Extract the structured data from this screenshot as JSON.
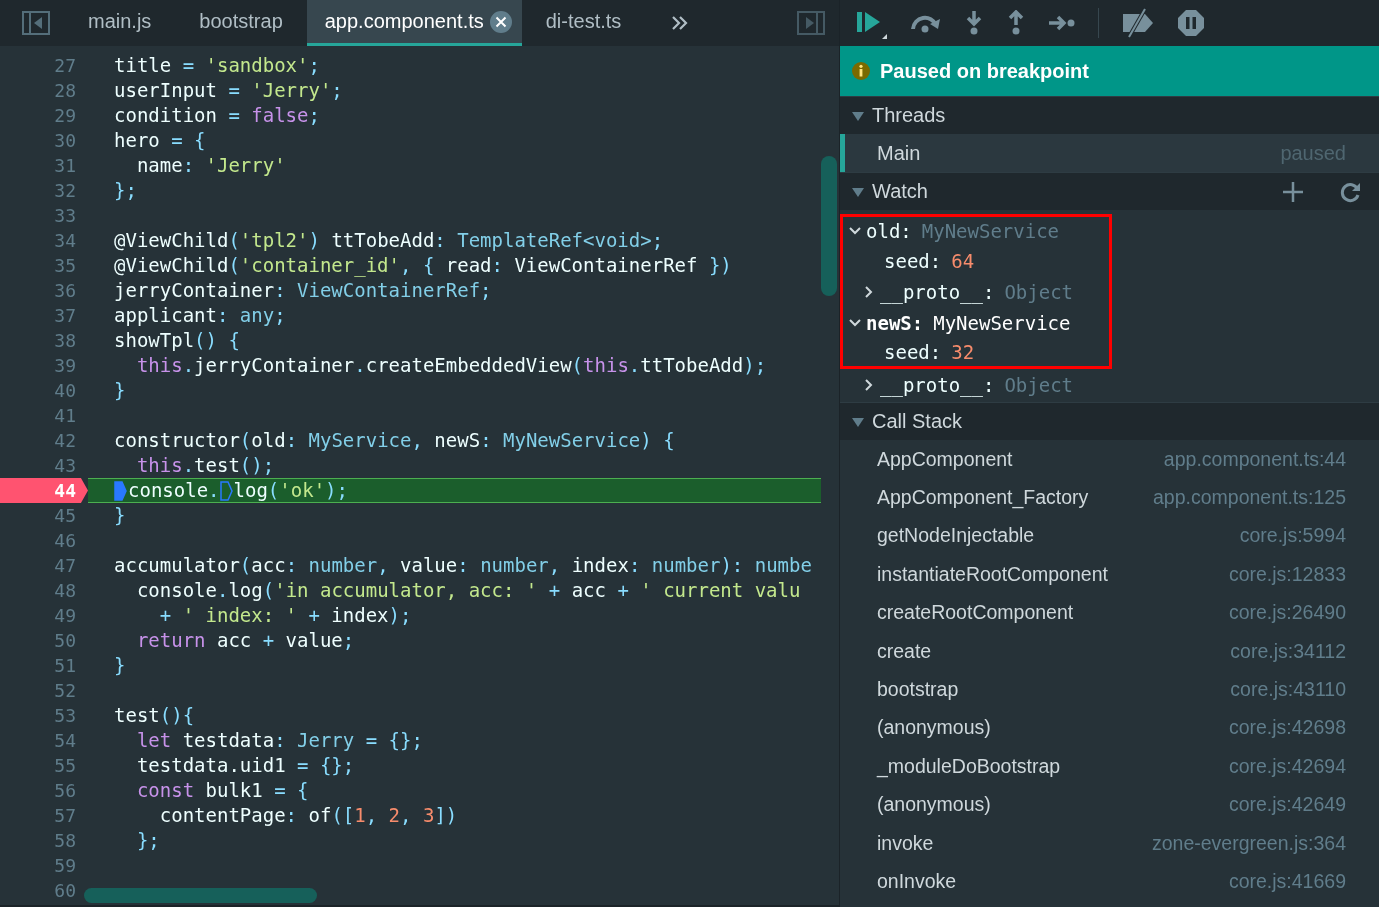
{
  "tabs": [
    {
      "label": "main.js",
      "selected": false
    },
    {
      "label": "bootstrap",
      "selected": false
    },
    {
      "label": "app.component.ts",
      "selected": true
    },
    {
      "label": "di-test.ts",
      "selected": false
    }
  ],
  "editor": {
    "lines": [
      {
        "number": "27",
        "kind": "code",
        "tokens": [
          {
            "kind": "plain",
            "text": "title "
          },
          {
            "kind": "punct",
            "text": "= "
          },
          {
            "kind": "string",
            "text": "'sandbox'"
          },
          {
            "kind": "punct",
            "text": ";"
          }
        ]
      },
      {
        "number": "28",
        "kind": "code",
        "tokens": [
          {
            "kind": "plain",
            "text": "userInput "
          },
          {
            "kind": "punct",
            "text": "= "
          },
          {
            "kind": "string",
            "text": "'Jerry'"
          },
          {
            "kind": "punct",
            "text": ";"
          }
        ]
      },
      {
        "number": "29",
        "kind": "code",
        "tokens": [
          {
            "kind": "plain",
            "text": "condition "
          },
          {
            "kind": "punct",
            "text": "= "
          },
          {
            "kind": "keyword",
            "text": "false"
          },
          {
            "kind": "punct",
            "text": ";"
          }
        ]
      },
      {
        "number": "30",
        "kind": "code",
        "tokens": [
          {
            "kind": "plain",
            "text": "hero "
          },
          {
            "kind": "punct",
            "text": "= {"
          }
        ]
      },
      {
        "number": "31",
        "kind": "code",
        "tokens": [
          {
            "kind": "plain",
            "text": "  name"
          },
          {
            "kind": "punct",
            "text": ": "
          },
          {
            "kind": "string",
            "text": "'Jerry'"
          }
        ]
      },
      {
        "number": "32",
        "kind": "code",
        "tokens": [
          {
            "kind": "punct",
            "text": "};"
          }
        ]
      },
      {
        "number": "33",
        "kind": "code"
      },
      {
        "number": "34",
        "kind": "code",
        "tokens": [
          {
            "kind": "plain",
            "text": "@ViewChild"
          },
          {
            "kind": "punct",
            "text": "("
          },
          {
            "kind": "string",
            "text": "'tpl2'"
          },
          {
            "kind": "punct",
            "text": ")"
          },
          {
            "kind": "plain",
            "text": " ttTobeAdd"
          },
          {
            "kind": "punct",
            "text": ": "
          },
          {
            "kind": "type",
            "text": "TemplateRef<void>"
          },
          {
            "kind": "punct",
            "text": ";"
          }
        ]
      },
      {
        "number": "35",
        "kind": "code",
        "tokens": [
          {
            "kind": "plain",
            "text": "@ViewChild"
          },
          {
            "kind": "punct",
            "text": "("
          },
          {
            "kind": "string",
            "text": "'container_id'"
          },
          {
            "kind": "punct",
            "text": ", { "
          },
          {
            "kind": "plain",
            "text": "read"
          },
          {
            "kind": "punct",
            "text": ": "
          },
          {
            "kind": "plain",
            "text": "ViewContainerRef"
          },
          {
            "kind": "punct",
            "text": " })"
          }
        ]
      },
      {
        "number": "36",
        "kind": "code",
        "tokens": [
          {
            "kind": "plain",
            "text": "jerryContainer"
          },
          {
            "kind": "punct",
            "text": ": "
          },
          {
            "kind": "type",
            "text": "ViewContainerRef"
          },
          {
            "kind": "punct",
            "text": ";"
          }
        ]
      },
      {
        "number": "37",
        "kind": "code",
        "tokens": [
          {
            "kind": "plain",
            "text": "applicant"
          },
          {
            "kind": "punct",
            "text": ": "
          },
          {
            "kind": "type",
            "text": "any"
          },
          {
            "kind": "punct",
            "text": ";"
          }
        ]
      },
      {
        "number": "38",
        "kind": "code",
        "tokens": [
          {
            "kind": "plain",
            "text": "showTpl"
          },
          {
            "kind": "punct",
            "text": "() {"
          }
        ]
      },
      {
        "number": "39",
        "kind": "code",
        "tokens": [
          {
            "kind": "keyword",
            "text": "  this"
          },
          {
            "kind": "punct",
            "text": "."
          },
          {
            "kind": "plain",
            "text": "jerryContainer"
          },
          {
            "kind": "punct",
            "text": "."
          },
          {
            "kind": "plain",
            "text": "createEmbeddedView"
          },
          {
            "kind": "punct",
            "text": "("
          },
          {
            "kind": "keyword",
            "text": "this"
          },
          {
            "kind": "punct",
            "text": "."
          },
          {
            "kind": "plain",
            "text": "ttTobeAdd"
          },
          {
            "kind": "punct",
            "text": ");"
          }
        ]
      },
      {
        "number": "40",
        "kind": "code",
        "tokens": [
          {
            "kind": "punct",
            "text": "}"
          }
        ]
      },
      {
        "number": "41",
        "kind": "code"
      },
      {
        "number": "42",
        "kind": "code",
        "tokens": [
          {
            "kind": "plain",
            "text": "constructor"
          },
          {
            "kind": "punct",
            "text": "("
          },
          {
            "kind": "plain",
            "text": "old"
          },
          {
            "kind": "punct",
            "text": ": "
          },
          {
            "kind": "type",
            "text": "MyService"
          },
          {
            "kind": "punct",
            "text": ", "
          },
          {
            "kind": "plain",
            "text": "newS"
          },
          {
            "kind": "punct",
            "text": ": "
          },
          {
            "kind": "type",
            "text": "MyNewService"
          },
          {
            "kind": "punct",
            "text": ") {"
          }
        ]
      },
      {
        "number": "43",
        "kind": "code",
        "tokens": [
          {
            "kind": "keyword",
            "text": "  this"
          },
          {
            "kind": "punct",
            "text": "."
          },
          {
            "kind": "plain",
            "text": "test"
          },
          {
            "kind": "punct",
            "text": "();"
          }
        ]
      },
      {
        "number": "44",
        "kind": "breakpoint",
        "tokens": [
          {
            "kind": "marker"
          },
          {
            "kind": "plain",
            "text": "console"
          },
          {
            "kind": "punct",
            "text": "."
          },
          {
            "kind": "marker"
          },
          {
            "kind": "plain",
            "text": "log"
          },
          {
            "kind": "punct",
            "text": "("
          },
          {
            "kind": "string",
            "text": "'ok'"
          },
          {
            "kind": "punct",
            "text": ");"
          }
        ]
      },
      {
        "number": "45",
        "kind": "code",
        "tokens": [
          {
            "kind": "punct",
            "text": "}"
          }
        ]
      },
      {
        "number": "46",
        "kind": "code"
      },
      {
        "number": "47",
        "kind": "code",
        "tokens": [
          {
            "kind": "plain",
            "text": "accumulator"
          },
          {
            "kind": "punct",
            "text": "("
          },
          {
            "kind": "plain",
            "text": "acc"
          },
          {
            "kind": "punct",
            "text": ": "
          },
          {
            "kind": "type",
            "text": "number"
          },
          {
            "kind": "punct",
            "text": ", "
          },
          {
            "kind": "plain",
            "text": "value"
          },
          {
            "kind": "punct",
            "text": ": "
          },
          {
            "kind": "type",
            "text": "number"
          },
          {
            "kind": "punct",
            "text": ", "
          },
          {
            "kind": "plain",
            "text": "index"
          },
          {
            "kind": "punct",
            "text": ": "
          },
          {
            "kind": "type",
            "text": "number"
          },
          {
            "kind": "punct",
            "text": "): "
          },
          {
            "kind": "type",
            "text": "numbe"
          }
        ]
      },
      {
        "number": "48",
        "kind": "code",
        "tokens": [
          {
            "kind": "plain",
            "text": "  console"
          },
          {
            "kind": "punct",
            "text": "."
          },
          {
            "kind": "plain",
            "text": "log"
          },
          {
            "kind": "punct",
            "text": "("
          },
          {
            "kind": "string",
            "text": "'in accumulator, acc: '"
          },
          {
            "kind": "punct",
            "text": " + "
          },
          {
            "kind": "plain",
            "text": "acc"
          },
          {
            "kind": "punct",
            "text": " + "
          },
          {
            "kind": "string",
            "text": "' current valu"
          }
        ]
      },
      {
        "number": "49",
        "kind": "code",
        "tokens": [
          {
            "kind": "punct",
            "text": "    + "
          },
          {
            "kind": "string",
            "text": "' index: '"
          },
          {
            "kind": "punct",
            "text": " + "
          },
          {
            "kind": "plain",
            "text": "index"
          },
          {
            "kind": "punct",
            "text": ");"
          }
        ]
      },
      {
        "number": "50",
        "kind": "code",
        "tokens": [
          {
            "kind": "keyword",
            "text": "  return"
          },
          {
            "kind": "plain",
            "text": " acc "
          },
          {
            "kind": "punct",
            "text": "+ "
          },
          {
            "kind": "plain",
            "text": "value"
          },
          {
            "kind": "punct",
            "text": ";"
          }
        ]
      },
      {
        "number": "51",
        "kind": "code",
        "tokens": [
          {
            "kind": "punct",
            "text": "}"
          }
        ]
      },
      {
        "number": "52",
        "kind": "code"
      },
      {
        "number": "53",
        "kind": "code",
        "tokens": [
          {
            "kind": "plain",
            "text": "test"
          },
          {
            "kind": "punct",
            "text": "(){"
          }
        ]
      },
      {
        "number": "54",
        "kind": "code",
        "tokens": [
          {
            "kind": "keyword",
            "text": "  let"
          },
          {
            "kind": "plain",
            "text": " testdata"
          },
          {
            "kind": "punct",
            "text": ": "
          },
          {
            "kind": "type",
            "text": "Jerry"
          },
          {
            "kind": "punct",
            "text": " = {};"
          }
        ]
      },
      {
        "number": "55",
        "kind": "code",
        "tokens": [
          {
            "kind": "plain",
            "text": "  testdata.uid1"
          },
          {
            "kind": "punct",
            "text": " = {};"
          }
        ]
      },
      {
        "number": "56",
        "kind": "code",
        "tokens": [
          {
            "kind": "keyword",
            "text": "  const"
          },
          {
            "kind": "plain",
            "text": " bulk1"
          },
          {
            "kind": "punct",
            "text": " = {"
          }
        ]
      },
      {
        "number": "57",
        "kind": "code",
        "tokens": [
          {
            "kind": "plain",
            "text": "    contentPage"
          },
          {
            "kind": "punct",
            "text": ": "
          },
          {
            "kind": "plain",
            "text": "of"
          },
          {
            "kind": "punct",
            "text": "(["
          },
          {
            "kind": "number",
            "text": "1"
          },
          {
            "kind": "punct",
            "text": ", "
          },
          {
            "kind": "number",
            "text": "2"
          },
          {
            "kind": "punct",
            "text": ", "
          },
          {
            "kind": "number",
            "text": "3"
          },
          {
            "kind": "punct",
            "text": "])"
          }
        ]
      },
      {
        "number": "58",
        "kind": "code",
        "tokens": [
          {
            "kind": "punct",
            "text": "  };"
          }
        ]
      },
      {
        "number": "59",
        "kind": "code"
      },
      {
        "number": "60",
        "kind": "code"
      }
    ]
  },
  "debugger": {
    "banner": "Paused on breakpoint",
    "threads": {
      "title": "Threads",
      "expanded": true,
      "items": [
        {
          "name": "Main",
          "status": "paused",
          "selected": true
        }
      ]
    },
    "watch": {
      "title": "Watch",
      "expanded": true,
      "items": [
        {
          "name": "old:",
          "value": "MyNewService",
          "kind": "object",
          "expanded": true,
          "selected": false,
          "highlighted": true,
          "children": [
            {
              "name": "seed:",
              "value": "64",
              "kind": "number",
              "highlighted": true
            },
            {
              "name": "__proto__:",
              "value": "Object",
              "kind": "object",
              "expanded": false,
              "highlighted": true
            }
          ]
        },
        {
          "name": "newS:",
          "value": "MyNewService",
          "kind": "object",
          "expanded": true,
          "selected": true,
          "highlighted": true,
          "children": [
            {
              "name": "seed:",
              "value": "32",
              "kind": "number",
              "highlighted": true
            },
            {
              "name": "__proto__:",
              "value": "Object",
              "kind": "object",
              "expanded": false,
              "highlighted": false
            }
          ]
        }
      ]
    },
    "call_stack": {
      "title": "Call Stack",
      "expanded": true,
      "frames": [
        {
          "name": "AppComponent",
          "location": "app.component.ts:44"
        },
        {
          "name": "AppComponent_Factory",
          "location": "app.component.ts:125"
        },
        {
          "name": "getNodeInjectable",
          "location": "core.js:5994"
        },
        {
          "name": "instantiateRootComponent",
          "location": "core.js:12833"
        },
        {
          "name": "createRootComponent",
          "location": "core.js:26490"
        },
        {
          "name": "create",
          "location": "core.js:34112"
        },
        {
          "name": "bootstrap",
          "location": "core.js:43110"
        },
        {
          "name": "(anonymous)",
          "location": "core.js:42698"
        },
        {
          "name": "_moduleDoBootstrap",
          "location": "core.js:42694"
        },
        {
          "name": "(anonymous)",
          "location": "core.js:42649"
        },
        {
          "name": "invoke",
          "location": "zone-evergreen.js:364"
        },
        {
          "name": "onInvoke",
          "location": "core.js:41669"
        }
      ]
    }
  }
}
